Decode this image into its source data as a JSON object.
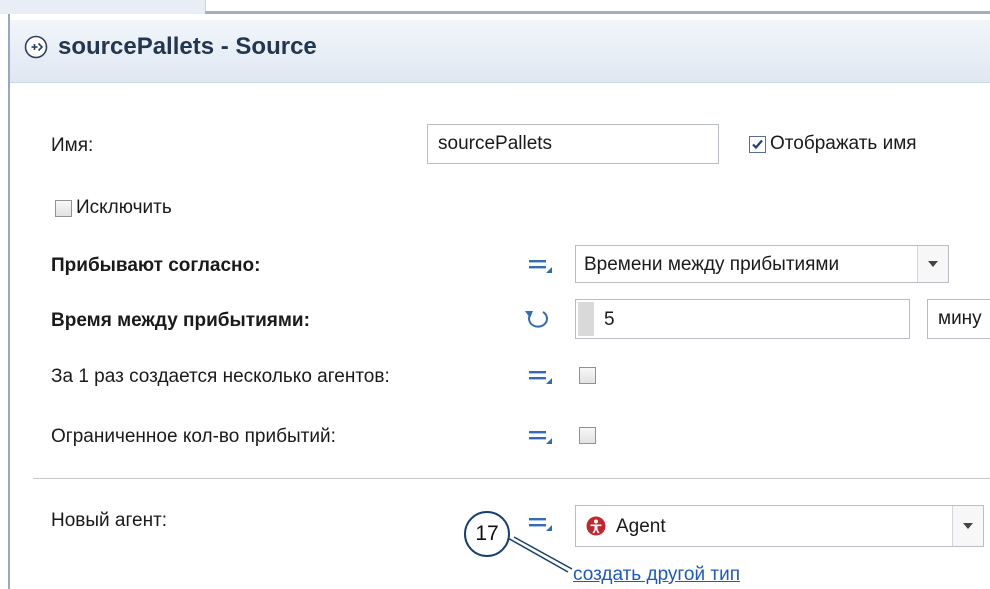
{
  "header": {
    "title": "sourcePallets - Source"
  },
  "fields": {
    "name_label": "Имя:",
    "name_value": "sourcePallets",
    "show_name_label": "Отображать имя",
    "exclude_label": "Исключить",
    "arrive_label": "Прибывают согласно:",
    "arrive_value": "Времени между прибытиями",
    "interarrival_label": "Время между прибытиями:",
    "interarrival_value": "5",
    "interarrival_unit": "мину",
    "multiple_label": "За 1 раз создается несколько агентов:",
    "limited_label": "Ограниченное кол-во прибытий:",
    "new_agent_label": "Новый агент:",
    "new_agent_value": "Agent",
    "create_link": "создать другой тип"
  },
  "state": {
    "show_name_checked": true,
    "exclude_checked": false,
    "multiple_checked": false,
    "limited_checked": false
  },
  "callout": {
    "number": "17"
  },
  "icons": {
    "header": "source-block-icon",
    "static_value": "equals-icon",
    "dynamic_value": "refresh-arrow-icon",
    "agent": "agent-person-icon",
    "dropdown": "chevron-down-icon"
  },
  "colors": {
    "accent": "#2f6db5",
    "link": "#1f58c5",
    "agent_icon": "#c2272d",
    "title": "#23364f"
  }
}
